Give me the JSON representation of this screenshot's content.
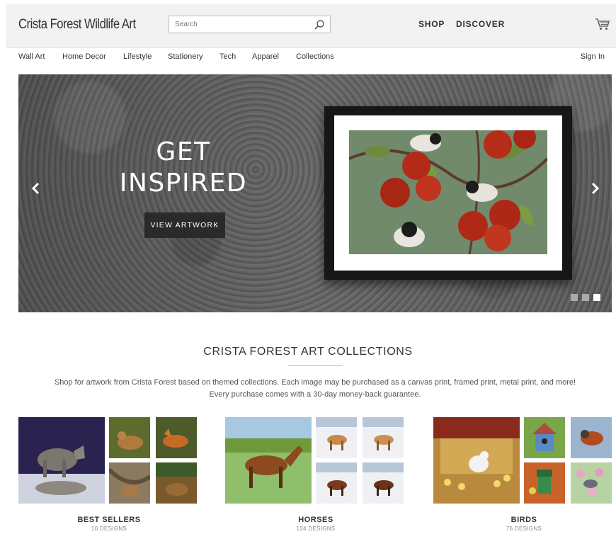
{
  "header": {
    "brand": "Crista Forest Wildlife Art",
    "search_placeholder": "Search",
    "nav": [
      "SHOP",
      "DISCOVER"
    ],
    "icons": {
      "search": "search-icon",
      "cart": "cart-icon"
    }
  },
  "categories": [
    "Wall Art",
    "Home Decor",
    "Lifestyle",
    "Stationery",
    "Tech",
    "Apparel",
    "Collections"
  ],
  "signin": "Sign In",
  "hero": {
    "title_line1": "GET",
    "title_line2": "INSPIRED",
    "button": "VIEW ARTWORK",
    "slides": 3,
    "active_slide": 3,
    "icons": {
      "prev": "chevron-left-icon",
      "next": "chevron-right-icon"
    }
  },
  "collections_section": {
    "title": "CRISTA FOREST ART COLLECTIONS",
    "description": "Shop for artwork from Crista Forest based on themed collections. Each image may be purchased as a canvas print, framed print, metal print, and more! Every purchase comes with a 30-day money-back guarantee.",
    "items": [
      {
        "name": "BEST SELLERS",
        "count": "10 DESIGNS"
      },
      {
        "name": "HORSES",
        "count": "124 DESIGNS"
      },
      {
        "name": "BIRDS",
        "count": "76 DESIGNS"
      }
    ]
  },
  "colors": {
    "header_bg": "#f2f2f2",
    "hero_button": "#2a2a2a",
    "text": "#333333"
  }
}
